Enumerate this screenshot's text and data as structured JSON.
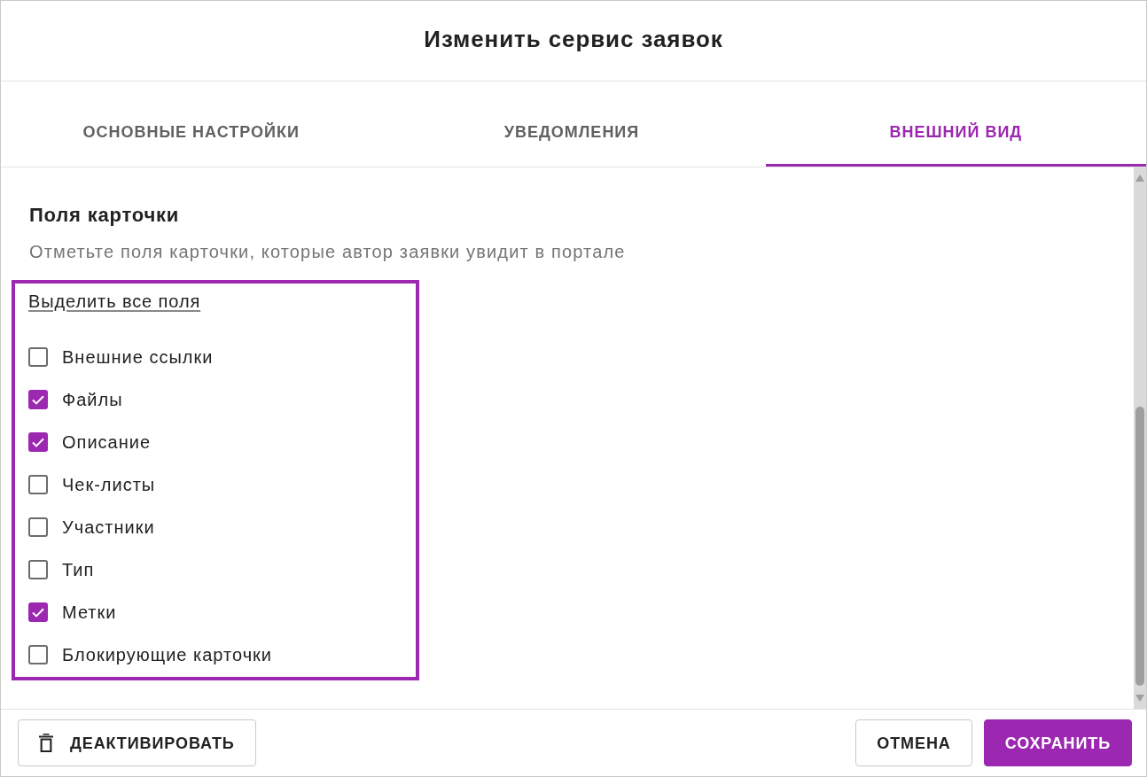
{
  "dialog": {
    "title": "Изменить сервис заявок"
  },
  "tabs": [
    {
      "label": "ОСНОВНЫЕ НАСТРОЙКИ",
      "selected": false
    },
    {
      "label": "УВЕДОМЛЕНИЯ",
      "selected": false
    },
    {
      "label": "ВНЕШНИЙ ВИД",
      "selected": true
    }
  ],
  "section": {
    "heading": "Поля карточки",
    "description": "Отметьте поля карточки, которые автор заявки увидит в портале",
    "highlighted": true,
    "select_all_link": "Выделить все поля",
    "fields": [
      {
        "label": "Внешние ссылки",
        "checked": false
      },
      {
        "label": "Файлы",
        "checked": true
      },
      {
        "label": "Описание",
        "checked": true
      },
      {
        "label": "Чек-листы",
        "checked": false
      },
      {
        "label": "Участники",
        "checked": false
      },
      {
        "label": "Тип",
        "checked": false
      },
      {
        "label": "Метки",
        "checked": true
      },
      {
        "label": "Блокирующие карточки",
        "checked": false
      }
    ]
  },
  "footer": {
    "buttons": [
      {
        "label": "ДЕАКТИВИРОВАТЬ",
        "kind": "delete"
      },
      {
        "label": "ОТМЕНА",
        "kind": "outline"
      },
      {
        "label": "СОХРАНИТЬ",
        "kind": "primary"
      }
    ]
  }
}
